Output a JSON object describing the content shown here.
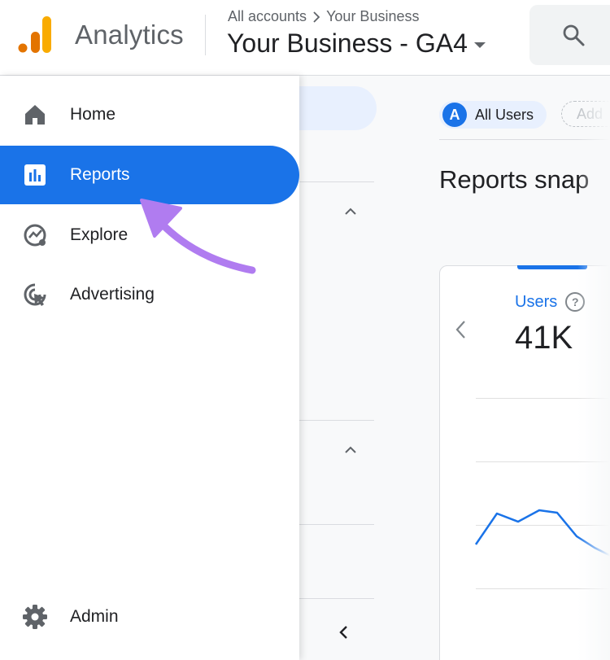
{
  "header": {
    "app_name": "Analytics",
    "breadcrumb": [
      "All accounts",
      "Your Business"
    ],
    "property_title": "Your Business - GA4"
  },
  "nav": {
    "items": [
      {
        "label": "Home",
        "icon": "home-icon"
      },
      {
        "label": "Reports",
        "icon": "bar-chart-icon",
        "active": true
      },
      {
        "label": "Explore",
        "icon": "explore-icon"
      },
      {
        "label": "Advertising",
        "icon": "advertising-icon"
      }
    ],
    "admin": {
      "label": "Admin",
      "icon": "gear-icon"
    }
  },
  "main": {
    "filter_chip": {
      "badge": "A",
      "label": "All Users"
    },
    "add_chip": "Add",
    "title": "Reports snap",
    "card": {
      "metric_label": "Users",
      "metric_value": "41K",
      "help": "?"
    }
  },
  "colors": {
    "accent": "#1a73e8",
    "annotation_arrow": "#b07cf0"
  }
}
